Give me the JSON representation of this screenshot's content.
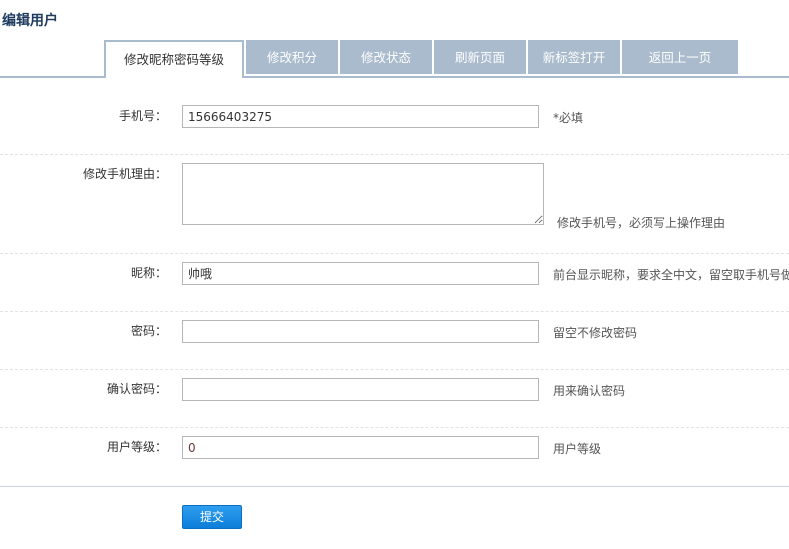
{
  "page": {
    "title": "编辑用户"
  },
  "tabs": [
    {
      "label": "修改昵称密码等级",
      "active": true
    },
    {
      "label": "修改积分",
      "active": false
    },
    {
      "label": "修改状态",
      "active": false
    },
    {
      "label": "刷新页面",
      "active": false
    },
    {
      "label": "新标签打开",
      "active": false
    },
    {
      "label": "返回上一页",
      "active": false
    }
  ],
  "form": {
    "phone": {
      "label": "手机号：",
      "value": "15666403275",
      "hint": "*必填"
    },
    "reason": {
      "label": "修改手机理由：",
      "value": "",
      "hint": "修改手机号，必须写上操作理由"
    },
    "nickname": {
      "label": "昵称：",
      "value": "帅哦",
      "hint": "前台显示昵称，要求全中文，留空取手机号做"
    },
    "password": {
      "label": "密码：",
      "value": "",
      "hint": "留空不修改密码"
    },
    "confirm": {
      "label": "确认密码：",
      "value": "",
      "hint": "用来确认密码"
    },
    "level": {
      "label": "用户等级：",
      "value": "0",
      "hint": "用户等级"
    }
  },
  "actions": {
    "submit_label": "提交"
  },
  "colors": {
    "tab_bg": "#a9bbcc",
    "accent": "#0c7ed9",
    "title": "#1e3a5f"
  }
}
